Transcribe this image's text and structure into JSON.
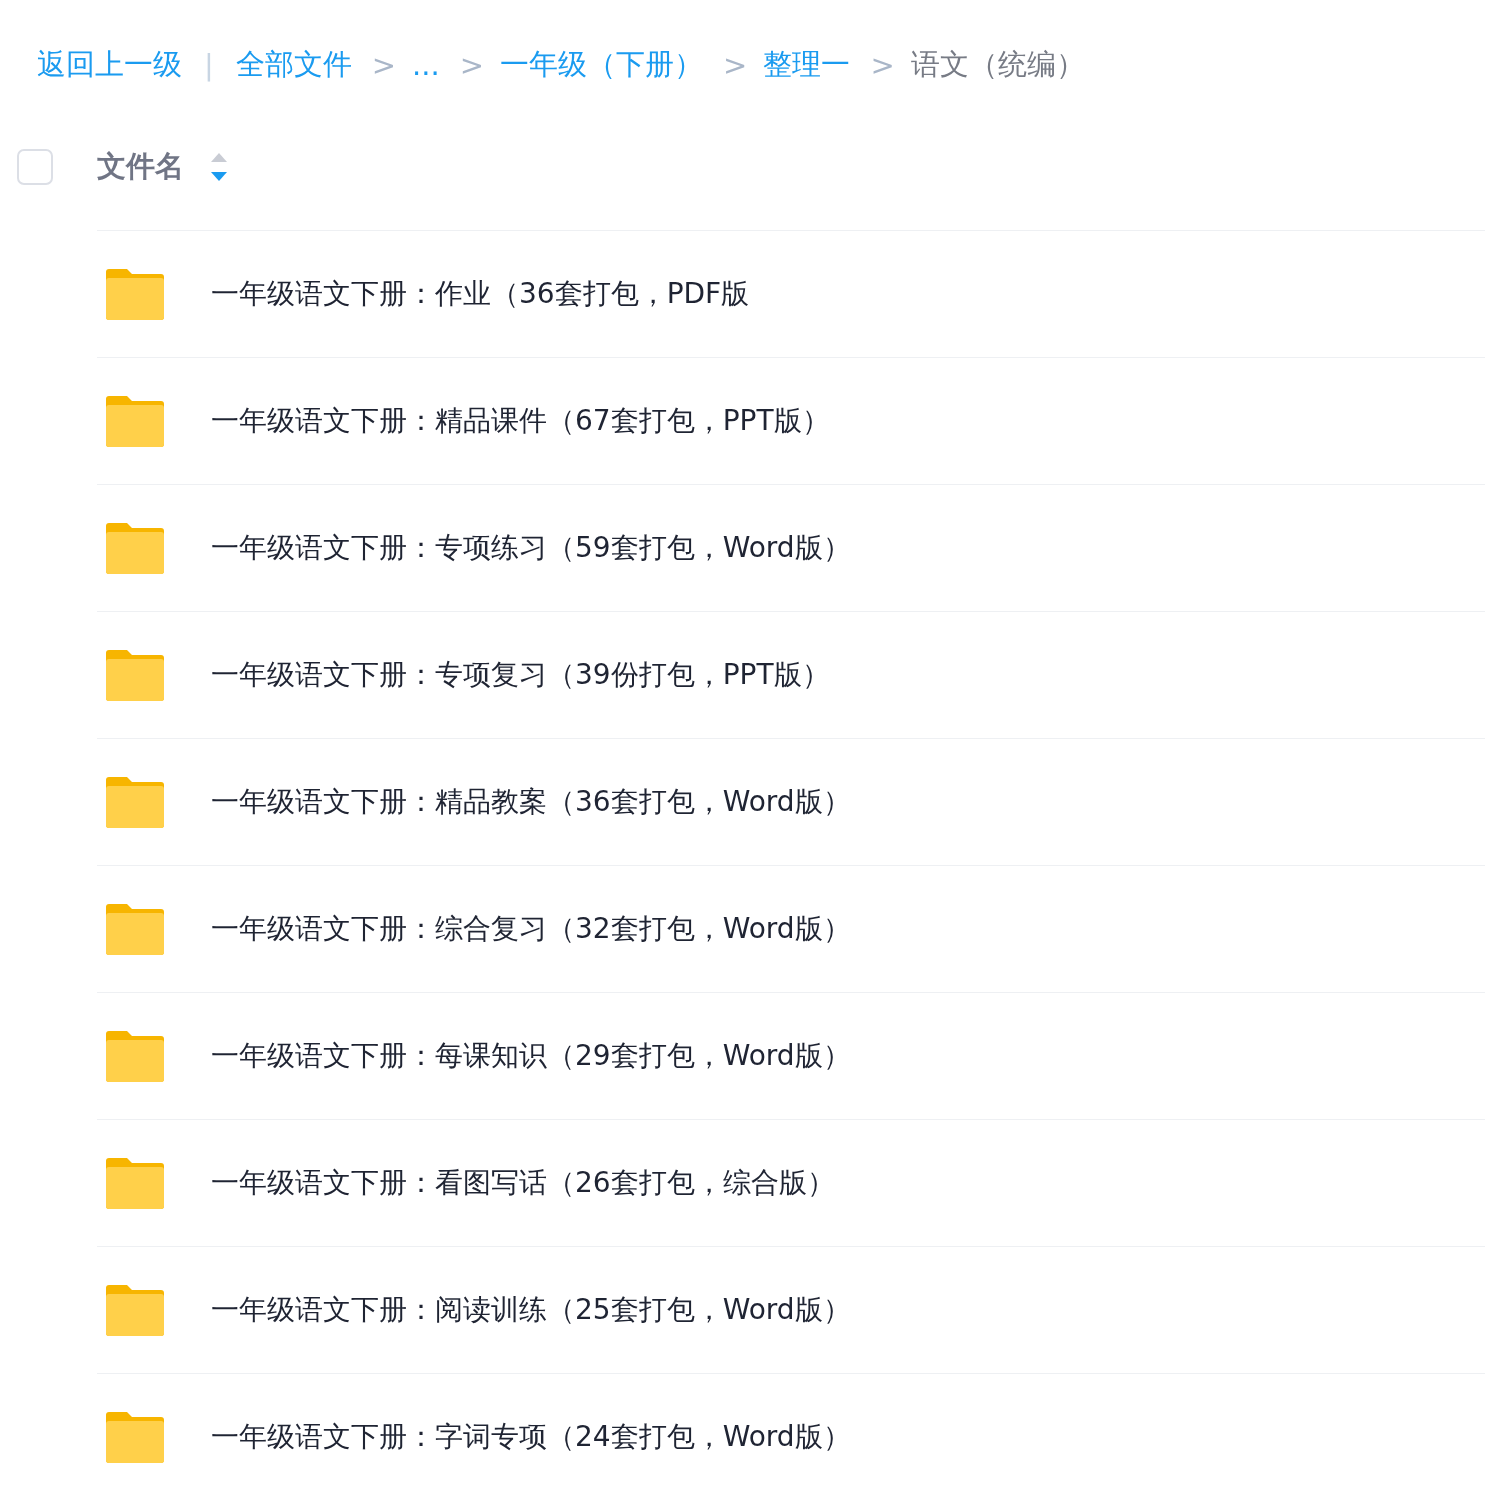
{
  "breadcrumb": {
    "back": "返回上一级",
    "separator": "|",
    "items": [
      {
        "label": "全部文件",
        "current": false
      },
      {
        "label": "...",
        "current": false
      },
      {
        "label": "一年级（下册）",
        "current": false
      },
      {
        "label": "整理一",
        "current": false
      },
      {
        "label": "语文（统编）",
        "current": true
      }
    ],
    "chevron": ">"
  },
  "table": {
    "select_all": {
      "checked": false
    },
    "column": {
      "label": "文件名",
      "sort_descending": true
    },
    "rows": [
      {
        "kind": "folder",
        "name": "一年级语文下册：作业（36套打包，PDF版"
      },
      {
        "kind": "folder",
        "name": "一年级语文下册：精品课件（67套打包，PPT版）"
      },
      {
        "kind": "folder",
        "name": "一年级语文下册：专项练习（59套打包，Word版）"
      },
      {
        "kind": "folder",
        "name": "一年级语文下册：专项复习（39份打包，PPT版）"
      },
      {
        "kind": "folder",
        "name": "一年级语文下册：精品教案（36套打包，Word版）"
      },
      {
        "kind": "folder",
        "name": "一年级语文下册：综合复习（32套打包，Word版）"
      },
      {
        "kind": "folder",
        "name": "一年级语文下册：每课知识（29套打包，Word版）"
      },
      {
        "kind": "folder",
        "name": "一年级语文下册：看图写话（26套打包，综合版）"
      },
      {
        "kind": "folder",
        "name": "一年级语文下册：阅读训练（25套打包，Word版）"
      },
      {
        "kind": "folder",
        "name": "一年级语文下册：字词专项（24套打包，Word版）"
      }
    ]
  }
}
